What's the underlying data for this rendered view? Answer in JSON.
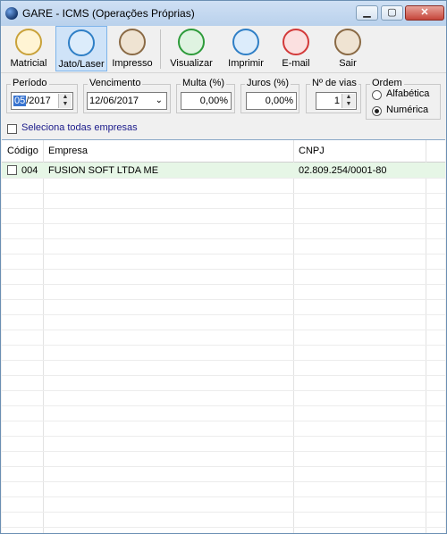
{
  "window": {
    "title": "GARE  - ICMS (Operações Próprias)"
  },
  "toolbar": {
    "buttons": [
      {
        "label": "Matricial",
        "icon": "dot-matrix-printer-icon",
        "color": "#c9a23a"
      },
      {
        "label": "Jato/Laser",
        "icon": "laser-printer-icon",
        "color": "#2f7fc6"
      },
      {
        "label": "Impresso",
        "icon": "stamp-icon",
        "color": "#8a6a45"
      },
      {
        "label": "Visualizar",
        "icon": "monitor-icon",
        "color": "#2d9b3a"
      },
      {
        "label": "Imprimir",
        "icon": "printer-icon",
        "color": "#2f7fc6"
      },
      {
        "label": "E-mail",
        "icon": "envelope-icon",
        "color": "#d33a3a"
      },
      {
        "label": "Sair",
        "icon": "exit-door-icon",
        "color": "#8a6a45"
      }
    ]
  },
  "form": {
    "periodo": {
      "label": "Período",
      "month": "05",
      "year": "/2017"
    },
    "vencimento": {
      "label": "Vencimento",
      "value": "12/06/2017"
    },
    "multa": {
      "label": "Multa (%)",
      "value": "0,00%"
    },
    "juros": {
      "label": "Juros (%)",
      "value": "0,00%"
    },
    "vias": {
      "label": "Nº de vias",
      "value": "1"
    },
    "ordem": {
      "label": "Ordem",
      "options": [
        "Alfabética",
        "Numérica"
      ],
      "selected": "Numérica"
    },
    "select_all": {
      "label": "Seleciona todas empresas",
      "checked": false
    }
  },
  "table": {
    "headers": [
      "Código",
      "Empresa",
      "CNPJ"
    ],
    "rows": [
      {
        "codigo": "004",
        "empresa": "FUSION SOFT LTDA ME",
        "cnpj": "02.809.254/0001-80",
        "checked": false
      }
    ]
  }
}
